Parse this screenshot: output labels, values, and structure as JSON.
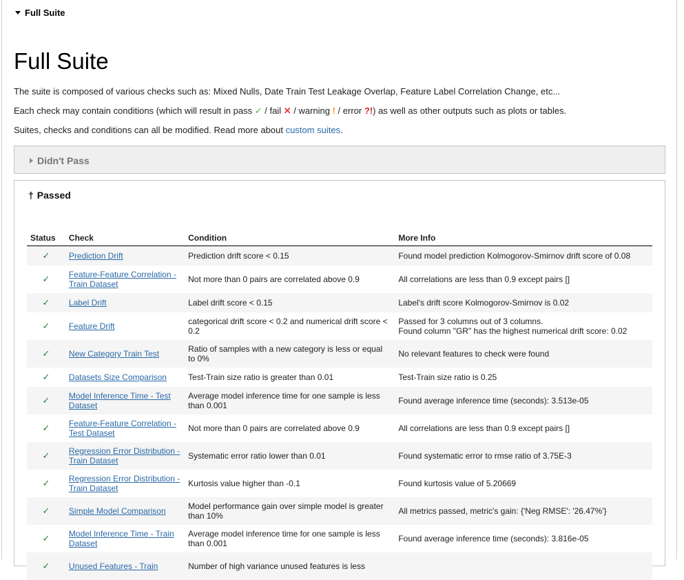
{
  "top_summary": "Full Suite",
  "title": "Full Suite",
  "paragraphs": {
    "p1": "The suite is composed of various checks such as: Mixed Nulls, Date Train Test Leakage Overlap, Feature Label Correlation Change, etc...",
    "p2_a": "Each check may contain conditions (which will result in pass ",
    "p2_pass": "✓",
    "p2_b": " / fail ",
    "p2_fail": "✕",
    "p2_c": " / warning ",
    "p2_warn": "!",
    "p2_d": " / error ",
    "p2_err": "?!",
    "p2_e": ") as well as other outputs such as plots or tables.",
    "p3_a": "Suites, checks and conditions can all be modified. Read more about ",
    "p3_link": "custom suites",
    "p3_b": "."
  },
  "didnt_pass": {
    "label": "Didn't Pass"
  },
  "passed": {
    "label": "Passed",
    "headers": {
      "status": "Status",
      "check": "Check",
      "condition": "Condition",
      "more_info": "More Info"
    },
    "rows": [
      {
        "status": "✓",
        "check": "Prediction Drift",
        "condition": "Prediction drift score < 0.15",
        "info": "Found model prediction Kolmogorov-Smirnov drift score of 0.08"
      },
      {
        "status": "✓",
        "check": "Feature-Feature Correlation - Train Dataset",
        "condition": "Not more than 0 pairs are correlated above 0.9",
        "info": "All correlations are less than 0.9 except pairs []"
      },
      {
        "status": "✓",
        "check": "Label Drift",
        "condition": "Label drift score < 0.15",
        "info": "Label's drift score Kolmogorov-Smirnov is 0.02"
      },
      {
        "status": "✓",
        "check": "Feature Drift",
        "condition": "categorical drift score < 0.2 and numerical drift score < 0.2",
        "info": "Passed for 3 columns out of 3 columns.",
        "info2": "Found column \"GR\" has the highest numerical drift score: 0.02"
      },
      {
        "status": "✓",
        "check": "New Category Train Test",
        "condition": "Ratio of samples with a new category is less or equal to 0%",
        "info": "No relevant features to check were found"
      },
      {
        "status": "✓",
        "check": "Datasets Size Comparison",
        "condition": "Test-Train size ratio is greater than 0.01",
        "info": "Test-Train size ratio is 0.25"
      },
      {
        "status": "✓",
        "check": "Model Inference Time - Test Dataset",
        "condition": "Average model inference time for one sample is less than 0.001",
        "info": "Found average inference time (seconds): 3.513e-05"
      },
      {
        "status": "✓",
        "check": "Feature-Feature Correlation - Test Dataset",
        "condition": "Not more than 0 pairs are correlated above 0.9",
        "info": "All correlations are less than 0.9 except pairs []"
      },
      {
        "status": "✓",
        "check": "Regression Error Distribution - Train Dataset",
        "condition": "Systematic error ratio lower than 0.01",
        "info": "Found systematic error to rmse ratio of 3.75E-3"
      },
      {
        "status": "✓",
        "check": "Regression Error Distribution - Train Dataset",
        "condition": "Kurtosis value higher than -0.1",
        "info": "Found kurtosis value of 5.20669"
      },
      {
        "status": "✓",
        "check": "Simple Model Comparison",
        "condition": "Model performance gain over simple model is greater than 10%",
        "info": "All metrics passed, metric's gain: {'Neg RMSE': '26.47%'}"
      },
      {
        "status": "✓",
        "check": "Model Inference Time - Train Dataset",
        "condition": "Average model inference time for one sample is less than 0.001",
        "info": "Found average inference time (seconds): 3.816e-05"
      },
      {
        "status": "✓",
        "check": "Unused Features - Train",
        "condition": "Number of high variance unused features is less",
        "info": ""
      }
    ]
  }
}
